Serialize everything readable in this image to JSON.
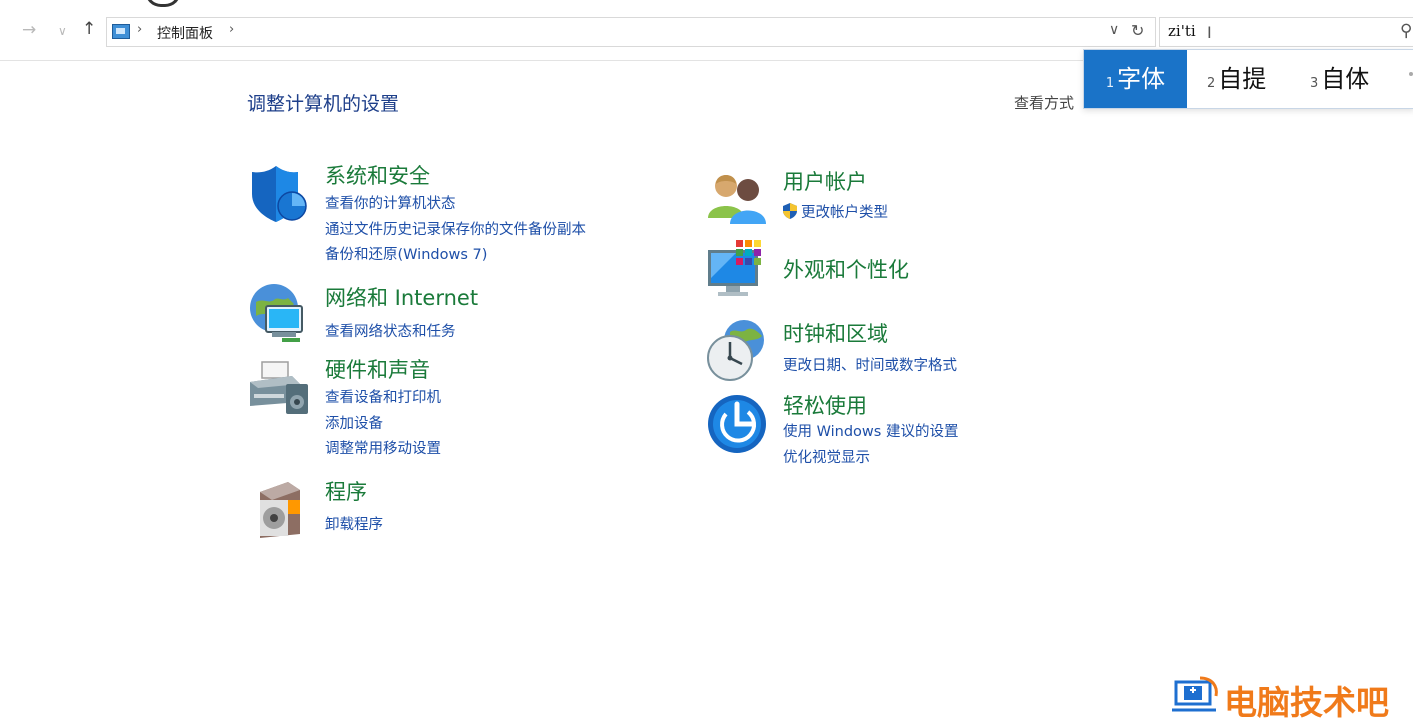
{
  "toolbar": {
    "back_glyph": "→",
    "forward_glyph": "∨",
    "up_glyph": "↑",
    "breadcrumb_sep": "›",
    "breadcrumb": "控制面板",
    "breadcrumb_trailing_sep": "›",
    "dropdown_glyph": "∨",
    "refresh_glyph": "↻"
  },
  "search": {
    "value": "zi'ti",
    "search_glyph": "⚲"
  },
  "ime": {
    "candidates": [
      {
        "num": "1",
        "text": "字体"
      },
      {
        "num": "2",
        "text": "自提"
      },
      {
        "num": "3",
        "text": "自体"
      }
    ]
  },
  "main": {
    "title": "调整计算机的设置",
    "view_by": "查看方式"
  },
  "categories": {
    "system": {
      "title": "系统和安全",
      "links": [
        "查看你的计算机状态",
        "通过文件历史记录保存你的文件备份副本",
        "备份和还原(Windows 7)"
      ]
    },
    "network": {
      "title": "网络和 Internet",
      "links": [
        "查看网络状态和任务"
      ]
    },
    "hardware": {
      "title": "硬件和声音",
      "links": [
        "查看设备和打印机",
        "添加设备",
        "调整常用移动设置"
      ]
    },
    "programs": {
      "title": "程序",
      "links": [
        "卸载程序"
      ]
    },
    "users": {
      "title": "用户帐户",
      "links": [
        "更改帐户类型"
      ]
    },
    "appearance": {
      "title": "外观和个性化",
      "links": []
    },
    "clock": {
      "title": "时钟和区域",
      "links": [
        "更改日期、时间或数字格式"
      ]
    },
    "ease": {
      "title": "轻松使用",
      "links": [
        "使用 Windows 建议的设置",
        "优化视觉显示"
      ]
    }
  },
  "watermark": {
    "text": "电脑技术吧"
  },
  "colors": {
    "heading_green": "#1a7a3a",
    "link_blue": "#1e4fa8",
    "ime_selected": "#1a73c8",
    "watermark_orange": "#f07a1a"
  }
}
